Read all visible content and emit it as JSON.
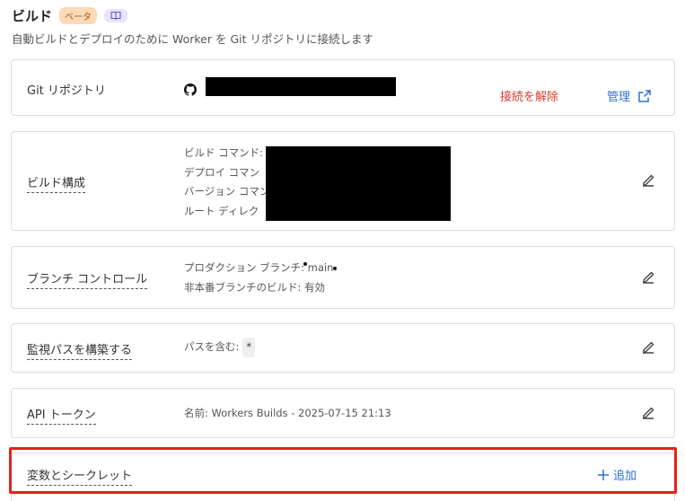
{
  "header": {
    "title": "ビルド",
    "badge": "ベータ",
    "subtitle": "自動ビルドとデプロイのために Worker を Git リポジトリに接続します"
  },
  "git": {
    "label": "Git リポジトリ",
    "disconnect": "接続を解除",
    "manage": "管理"
  },
  "build": {
    "label": "ビルド構成",
    "lines": [
      "ビルド コマンド:",
      "デプロイ コマン",
      "バージョン コマン",
      "ルート ディレク"
    ]
  },
  "branch": {
    "label": "ブランチ コントロール",
    "production": "プロダクション ブランチ: main",
    "non_production": "非本番ブランチのビルド: 有効"
  },
  "watch": {
    "label": "監視パスを構築する",
    "include_label": "パスを含む:",
    "include_value": "*"
  },
  "api": {
    "label": "API トークン",
    "name": "名前: Workers Builds - 2025-07-15 21:13"
  },
  "vars": {
    "label": "変数とシークレット",
    "add": "追加"
  },
  "colors": {
    "danger": "#d93a2f",
    "link": "#2f6fd6",
    "highlight": "#e8201a",
    "badge_bg": "#fbd9b7"
  }
}
